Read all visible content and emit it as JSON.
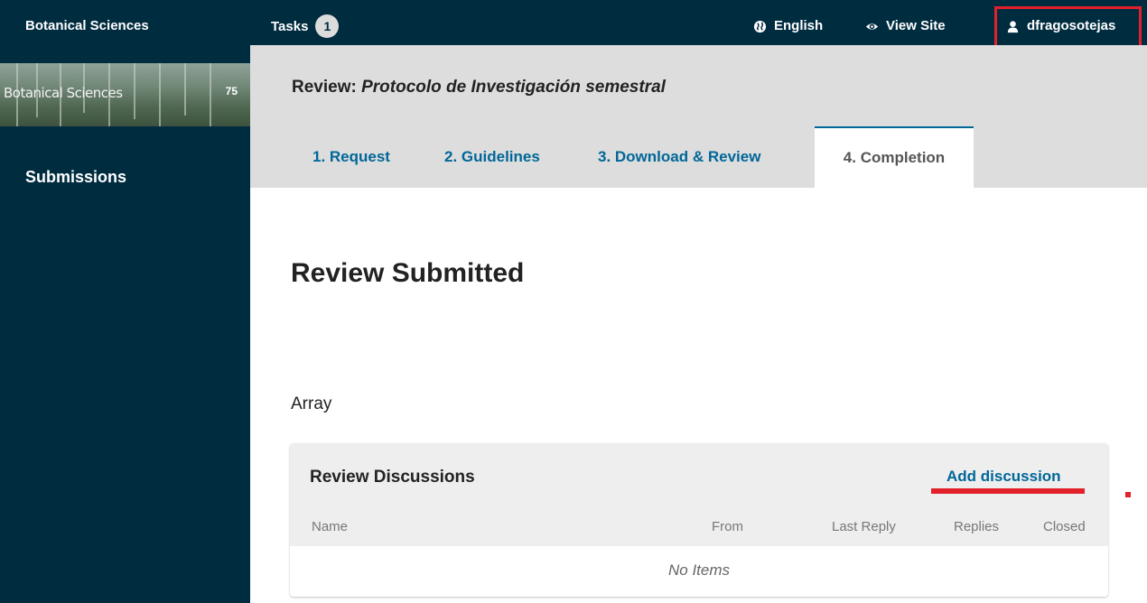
{
  "topbar": {
    "brand": "Botanical Sciences",
    "tasks_label": "Tasks",
    "tasks_count": "1",
    "language": "English",
    "view_site": "View Site",
    "username": "dfragosotejas"
  },
  "sidebar": {
    "logo_text": "Botanical Sciences",
    "items": [
      {
        "label": "Submissions"
      }
    ]
  },
  "review": {
    "title_prefix": "Review:",
    "title_name": "Protocolo de Investigación semestral"
  },
  "tabs": [
    {
      "label": "1. Request"
    },
    {
      "label": "2. Guidelines"
    },
    {
      "label": "3. Download & Review"
    },
    {
      "label": "4. Completion",
      "active": true
    }
  ],
  "main": {
    "heading": "Review Submitted",
    "array_text": "Array"
  },
  "discussions": {
    "title": "Review Discussions",
    "add_label": "Add discussion",
    "columns": [
      "Name",
      "From",
      "Last Reply",
      "Replies",
      "Closed"
    ],
    "empty_text": "No Items"
  },
  "colors": {
    "nav_bg": "#002c40",
    "link": "#006798",
    "highlight": "#e3212b",
    "header_band": "#dddddd"
  },
  "icons": {
    "language": "globe-icon",
    "view_site": "eye-icon",
    "user": "user-icon"
  }
}
